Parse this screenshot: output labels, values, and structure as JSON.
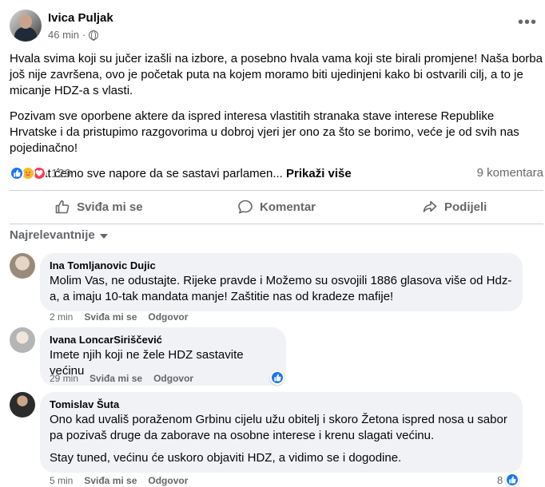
{
  "post": {
    "author": "Ivica Puljak",
    "time": "46 min",
    "dot": "·",
    "more": "•••",
    "paragraphs": [
      "Hvala svima koji su jučer izašli na izbore, a posebno hvala vama koji ste birali promjene! Naša borba još nije završena, ovo je početak puta na kojem moramo biti ujedinjeni kako bi ostvarili cilj, a to je micanje HDZ-a s vlasti.",
      "Pozivam sve oporbene aktere da ispred interesa vlastitih stranaka stave interese Republike Hrvatske i da pristupimo razgovorima u dobroj vjeri jer ono za što se borimo, veće je od svih nas pojedinačno!"
    ],
    "truncated": "Podržat ćemo sve napore da se sastavi parlamen...",
    "see_more": "Prikaži više",
    "reaction_count": "129",
    "comment_count": "9 komentara"
  },
  "actions": {
    "like": "Sviđa mi se",
    "comment": "Komentar",
    "share": "Podijeli"
  },
  "sort_label": "Najrelevantnije",
  "comments": [
    {
      "name": "Ina Tomljanovic Dujic",
      "text": [
        "Molim Vas, ne odustajte. Rijeke pravde i Možemo su osvojili 1886 glasova više od Hdz-a, a imaju 10-tak mandata manje! Zaštitie nas od kradeze mafije!"
      ],
      "time": "2 min",
      "like": "Sviđa mi se",
      "reply": "Odgovor"
    },
    {
      "name": "Ivana LoncarSiriščević",
      "text": [
        "Imete njih koji ne žele HDZ sastavite većinu"
      ],
      "time": "29 min",
      "like": "Sviđa mi se",
      "reply": "Odgovor"
    },
    {
      "name": "Tomislav Šuta",
      "text": [
        "Ono kad uvališ poraženom Grbinu cijelu užu obitelj i skoro Žetona ispred nosa u sabor pa pozivaš druge da zaborave na osobne interese i krenu slagati većinu.",
        "Stay tuned, većinu će uskoro objaviti HDZ, a vidimo se i dogodine."
      ],
      "time": "5 min",
      "like": "Sviđa mi se",
      "reply": "Odgovor",
      "reaction_count": "8"
    }
  ],
  "colors": {
    "accent": "#1877f2",
    "secondary_text": "#65676b",
    "bubble": "#f0f2f5"
  }
}
